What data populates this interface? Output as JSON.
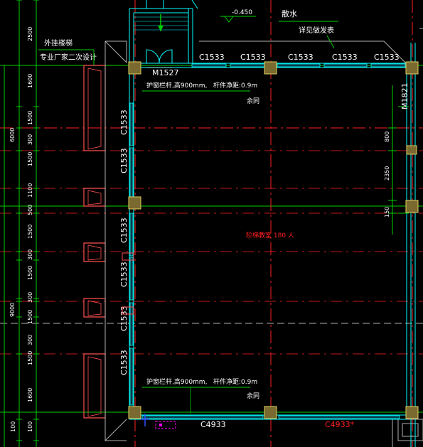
{
  "colors": {
    "background": "#000000",
    "wall": "#00ffff",
    "window_fill": "#0a3a4a",
    "column_fill": "#7a6a30",
    "column_stroke": "#e0d060",
    "axis_red": "#ff2020",
    "dim_green": "#00d000",
    "text_white": "#ffffff",
    "text_cyan": "#00ffff",
    "text_yellow": "#ffff00",
    "text_red": "#ff2020",
    "pier_red": "#ff5050",
    "magenta": "#ff00ff",
    "grey_outline": "#b0b0b0"
  },
  "left_dims": {
    "v1": [
      "2500",
      "1600",
      "1500",
      "300",
      "1500",
      "1100",
      "500",
      "1500",
      "300",
      "1500",
      "300",
      "1500",
      "300",
      "1500",
      "1600",
      "100"
    ],
    "v2": [
      "100"
    ],
    "overall": [
      "6000",
      "9000"
    ]
  },
  "right_dims": [
    "800",
    "2350",
    "150"
  ],
  "labels": {
    "elevation": "-0.450",
    "note1": "散水",
    "note2": "详见做发表",
    "exterior_stair1": "外挂楼梯",
    "exterior_stair2": "专业厂家二次设计",
    "door_top": "M1527",
    "door_right": "M1821",
    "rail_note_top": "护窗栏杆,高900mm,",
    "rail_note_top_b": "杆件净距:0.9m",
    "rail_note_top_c": "余同",
    "room_label": "阶梯教室 180 人",
    "rail_note_bottom": "护窗栏杆,高900mm,",
    "rail_note_bottom_b": "杆件净距:0.9m",
    "rail_note_bottom_c": "余同",
    "win_bottom": "C4933",
    "win_bottom_red": "C4933*"
  },
  "windows_top": [
    "C1533",
    "C1533",
    "C1533",
    "C1533",
    "C1533"
  ],
  "windows_left": [
    "C1533",
    "C1533",
    "C1533",
    "C1533",
    "C1533",
    "C1533"
  ]
}
